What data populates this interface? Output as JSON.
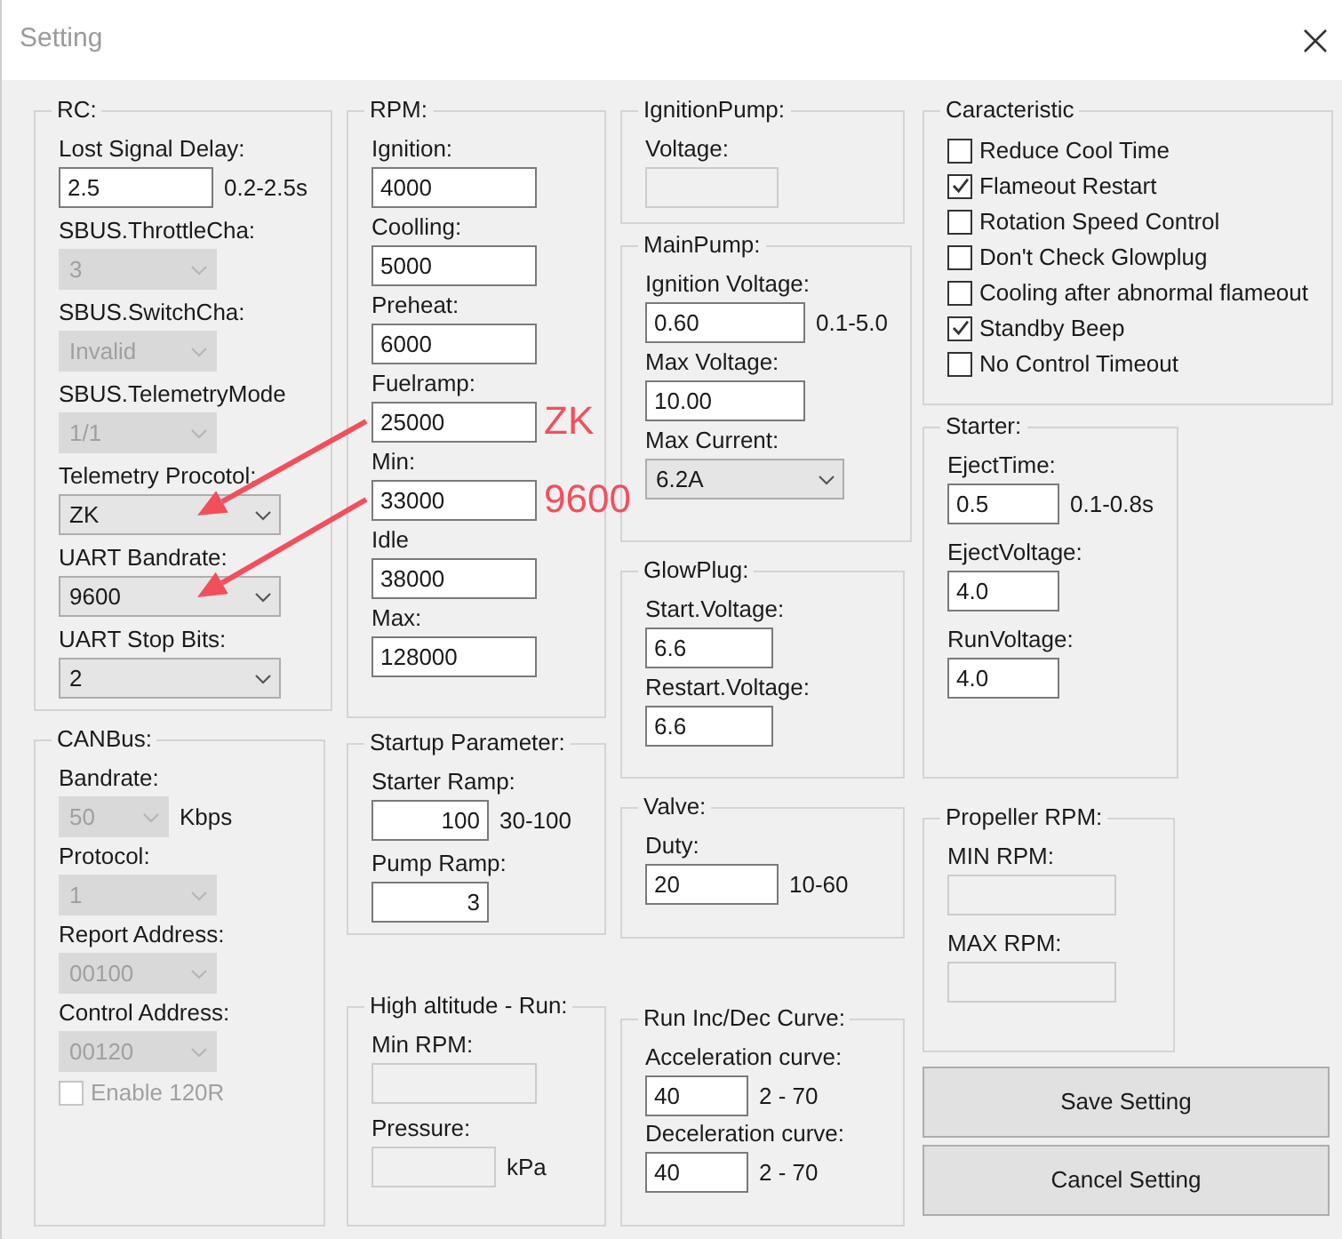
{
  "window": {
    "title": "Setting"
  },
  "columns": [
    [
      {
        "title": "RC:",
        "items": [
          {
            "kind": "input",
            "label": "Lost Signal Delay:",
            "value": "2.5",
            "suffix": "0.2-2.5s"
          },
          {
            "kind": "combo",
            "label": "SBUS.ThrottleCha:",
            "value": "3",
            "disabled": true
          },
          {
            "kind": "combo",
            "label": "SBUS.SwitchCha:",
            "value": "Invalid",
            "disabled": true
          },
          {
            "kind": "combo",
            "label": "SBUS.TelemetryMode",
            "value": "1/1",
            "disabled": true
          },
          {
            "kind": "combo",
            "label": "Telemetry Procotol:",
            "value": "ZK",
            "disabled": false
          },
          {
            "kind": "combo",
            "label": "UART Bandrate:",
            "value": "9600",
            "disabled": false
          },
          {
            "kind": "combo",
            "label": "UART Stop Bits:",
            "value": "2",
            "disabled": false
          }
        ]
      },
      {
        "title": "CANBus:",
        "items": [
          {
            "kind": "combo",
            "label": "Bandrate:",
            "value": "50",
            "suffix": "Kbps",
            "disabled": true
          },
          {
            "kind": "combo",
            "label": "Protocol:",
            "value": "1",
            "disabled": true
          },
          {
            "kind": "combo",
            "label": "Report Address:",
            "value": "00100",
            "disabled": true
          },
          {
            "kind": "combo",
            "label": "Control Address:",
            "value": "00120",
            "disabled": true
          },
          {
            "kind": "checkbox",
            "label": "Enable 120R",
            "checked": false,
            "disabled": true
          }
        ]
      }
    ],
    [
      {
        "title": "RPM:",
        "items": [
          {
            "kind": "input",
            "label": "Ignition:",
            "value": "4000"
          },
          {
            "kind": "input",
            "label": "Coolling:",
            "value": "5000"
          },
          {
            "kind": "input",
            "label": "Preheat:",
            "value": "6000"
          },
          {
            "kind": "input",
            "label": "Fuelramp:",
            "value": "25000"
          },
          {
            "kind": "input",
            "label": "Min:",
            "value": "33000"
          },
          {
            "kind": "input",
            "label": "Idle",
            "value": "38000"
          },
          {
            "kind": "input",
            "label": "Max:",
            "value": "128000"
          }
        ]
      },
      {
        "title": "Startup Parameter:",
        "items": [
          {
            "kind": "input",
            "label": "Starter Ramp:",
            "value": "100",
            "suffix": "30-100",
            "right_aligned": true
          },
          {
            "kind": "input",
            "label": "Pump Ramp:",
            "value": "3",
            "right_aligned": true
          }
        ]
      },
      {
        "title": "High altitude - Run:",
        "items": [
          {
            "kind": "input",
            "label": "Min RPM:",
            "disabled": true
          },
          {
            "kind": "input",
            "label": "Pressure:",
            "suffix": "kPa",
            "disabled": true
          }
        ]
      }
    ],
    [
      {
        "title": "IgnitionPump:",
        "items": [
          {
            "kind": "input",
            "label": "Voltage:",
            "disabled": true
          }
        ]
      },
      {
        "title": "MainPump:",
        "items": [
          {
            "kind": "input",
            "label": "Ignition Voltage:",
            "value": "0.60",
            "suffix": "0.1-5.0"
          },
          {
            "kind": "input",
            "label": "Max Voltage:",
            "value": "10.00"
          },
          {
            "kind": "combo",
            "label": "Max Current:",
            "value": "6.2A",
            "disabled": false
          }
        ]
      },
      {
        "title": "GlowPlug:",
        "items": [
          {
            "kind": "input",
            "label": "Start.Voltage:",
            "value": "6.6"
          },
          {
            "kind": "input",
            "label": "Restart.Voltage:",
            "value": "6.6"
          }
        ]
      },
      {
        "title": "Valve:",
        "items": [
          {
            "kind": "input",
            "label": "Duty:",
            "value": "20",
            "suffix": "10-60"
          }
        ]
      },
      {
        "title": "Run Inc/Dec Curve:",
        "items": [
          {
            "kind": "input",
            "label": "Acceleration curve:",
            "value": "40",
            "suffix": "2 - 70"
          },
          {
            "kind": "input",
            "label": "Deceleration curve:",
            "value": "40",
            "suffix": "2 - 70"
          }
        ]
      }
    ],
    [
      {
        "title": "Caracteristic",
        "items": [
          {
            "kind": "checkbox",
            "label": "Reduce Cool Time",
            "checked": false
          },
          {
            "kind": "checkbox",
            "label": "Flameout Restart",
            "checked": true
          },
          {
            "kind": "checkbox",
            "label": "Rotation Speed Control",
            "checked": false
          },
          {
            "kind": "checkbox",
            "label": "Don't Check Glowplug",
            "checked": false
          },
          {
            "kind": "checkbox",
            "label": "Cooling after abnormal flameout",
            "checked": false
          },
          {
            "kind": "checkbox",
            "label": "Standby Beep",
            "checked": true
          },
          {
            "kind": "checkbox",
            "label": "No Control Timeout",
            "checked": false
          }
        ]
      },
      {
        "title": "Starter:",
        "items": [
          {
            "kind": "input",
            "label": "EjectTime:",
            "value": "0.5",
            "suffix": "0.1-0.8s"
          },
          {
            "kind": "input",
            "label": "EjectVoltage:",
            "value": "4.0"
          },
          {
            "kind": "input",
            "label": "RunVoltage:",
            "value": "4.0"
          }
        ]
      },
      {
        "title": "Propeller RPM:",
        "items": [
          {
            "kind": "input",
            "label": "MIN RPM:",
            "disabled": true
          },
          {
            "kind": "input",
            "label": "MAX RPM:",
            "disabled": true
          }
        ]
      }
    ]
  ],
  "buttons": [
    "Save Setting",
    "Cancel Setting"
  ],
  "annotations": [
    {
      "text": "ZK"
    },
    {
      "text": "9600"
    }
  ]
}
